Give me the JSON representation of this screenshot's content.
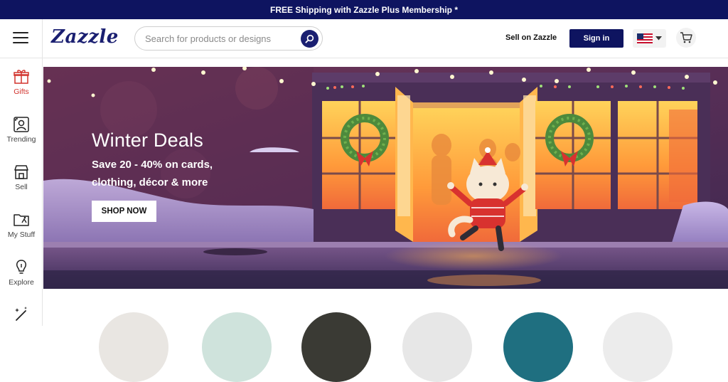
{
  "promo_banner": {
    "text": "FREE Shipping with Zazzle Plus Membership *"
  },
  "header": {
    "logo": "Zazzle",
    "search": {
      "placeholder": "Search for products or designs",
      "value": ""
    },
    "sell_link": "Sell on Zazzle",
    "sign_in": "Sign in",
    "flag_icon": "us-flag-icon",
    "cart_icon": "cart-icon"
  },
  "sidebar": {
    "items": [
      {
        "label": "Gifts",
        "icon": "gift-icon",
        "active": true
      },
      {
        "label": "Trending",
        "icon": "trending-icon",
        "active": false
      },
      {
        "label": "Sell",
        "icon": "store-icon",
        "active": false
      },
      {
        "label": "My Stuff",
        "icon": "folder-icon",
        "active": false
      },
      {
        "label": "Explore",
        "icon": "lightbulb-icon",
        "active": false
      },
      {
        "label": "",
        "icon": "magic-wand-icon",
        "active": false
      }
    ]
  },
  "hero": {
    "title": "Winter Deals",
    "subtitle_line1": "Save 20 - 40% on cards,",
    "subtitle_line2": "clothing, décor & more",
    "button": "SHOP NOW"
  },
  "category_circles": {
    "colors": [
      "#e9e6e2",
      "#cfe3dc",
      "#3a3a34",
      "#e7e7e7",
      "#1f6f80",
      "#ececec"
    ]
  },
  "colors": {
    "brand_navy": "#0e1460",
    "accent_red": "#d2332d"
  }
}
